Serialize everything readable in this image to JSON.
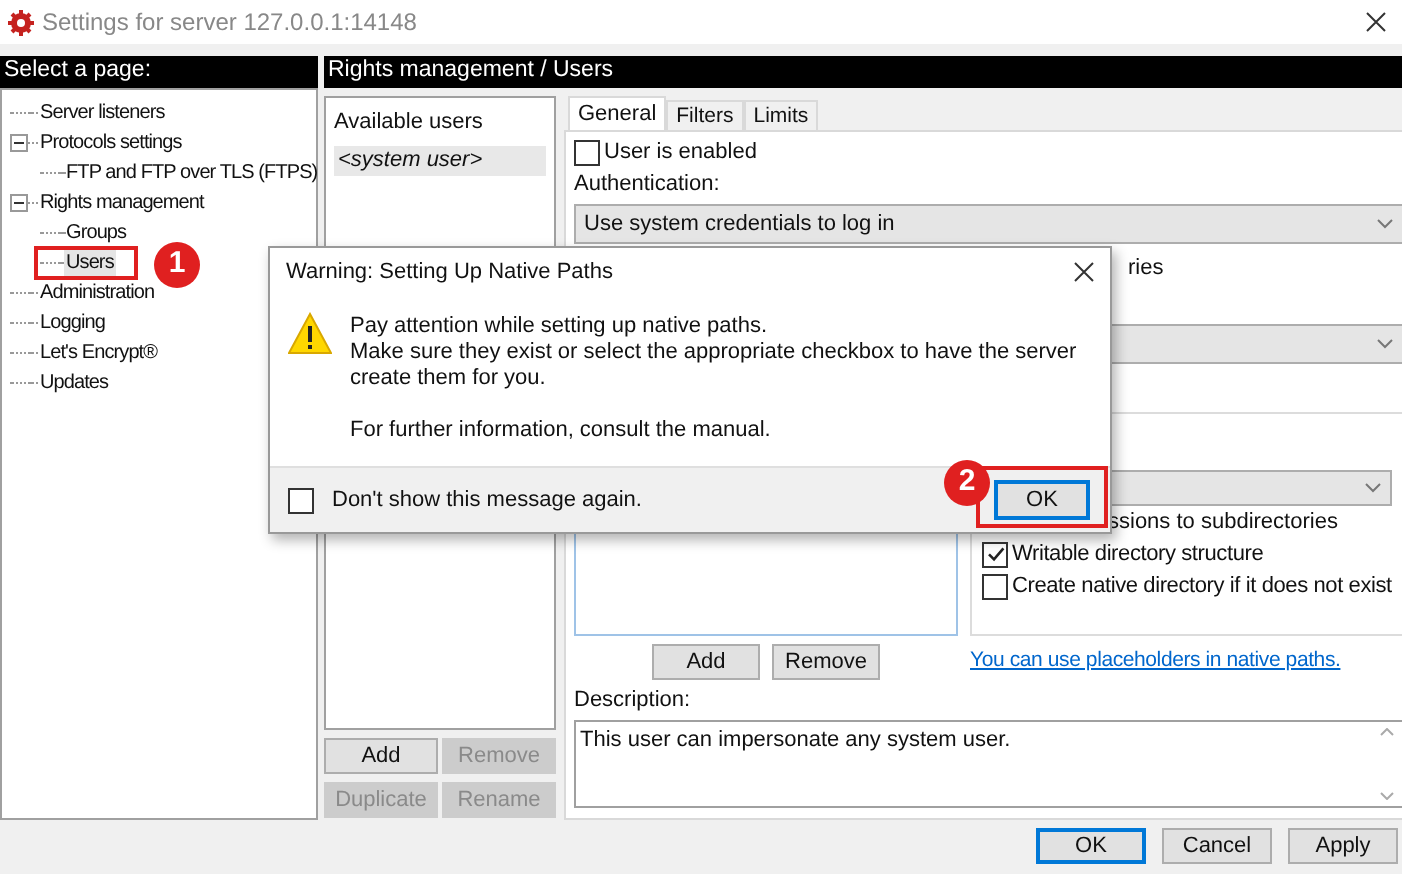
{
  "window": {
    "title": "Settings for server 127.0.0.1:14148"
  },
  "sidebar": {
    "header": "Select a page:",
    "items": [
      {
        "label": "Server listeners",
        "selected": false
      },
      {
        "label": "Protocols settings",
        "selected": false,
        "expanded": true,
        "children": [
          {
            "label": "FTP and FTP over TLS (FTPS)",
            "selected": false
          }
        ]
      },
      {
        "label": "Rights management",
        "selected": false,
        "expanded": true,
        "children": [
          {
            "label": "Groups",
            "selected": false
          },
          {
            "label": "Users",
            "selected": true
          }
        ]
      },
      {
        "label": "Administration",
        "selected": false
      },
      {
        "label": "Logging",
        "selected": false
      },
      {
        "label": "Let's Encrypt®",
        "selected": false
      },
      {
        "label": "Updates",
        "selected": false
      }
    ]
  },
  "page_header": "Rights management / Users",
  "users": {
    "header": "Available users",
    "items": [
      {
        "label": "<system user>",
        "selected": true
      }
    ],
    "buttons": [
      {
        "label": "Add",
        "disabled": false
      },
      {
        "label": "Remove",
        "disabled": true
      },
      {
        "label": "Duplicate",
        "disabled": true
      },
      {
        "label": "Rename",
        "disabled": true
      }
    ]
  },
  "tabs": [
    {
      "label": "General",
      "selected": true
    },
    {
      "label": "Filters",
      "selected": false
    },
    {
      "label": "Limits",
      "selected": false
    }
  ],
  "general": {
    "user_enabled": {
      "label": "User is enabled",
      "checked": false
    },
    "authentication_label": "Authentication:",
    "authentication": {
      "value": "Use system credentials to log in"
    },
    "partial_option": "ries",
    "partial_permission": "ssions to subdirectories",
    "permissions": [
      {
        "label": "Writable directory structure",
        "checked": true
      },
      {
        "label": "Create native directory if it does not exist",
        "checked": false
      }
    ],
    "path_buttons": [
      "Add",
      "Remove"
    ],
    "link": "You can use placeholders in native paths.",
    "description_label": "Description:",
    "description": "This user can impersonate any system user."
  },
  "footer_buttons": [
    {
      "label": "OK",
      "default": true
    },
    {
      "label": "Cancel",
      "default": false
    },
    {
      "label": "Apply",
      "default": false
    }
  ],
  "dialog": {
    "title": "Warning: Setting Up Native Paths",
    "lines": [
      "Pay attention while setting up native paths.",
      "Make sure they exist or select the appropriate checkbox to have the server create them for you."
    ],
    "note": "For further information, consult the manual.",
    "dont_show": {
      "label": "Don't show this message again.",
      "checked": false
    },
    "button": {
      "label": "OK",
      "default": true
    }
  },
  "annotations": [
    {
      "label": "1"
    },
    {
      "label": "2"
    }
  ]
}
